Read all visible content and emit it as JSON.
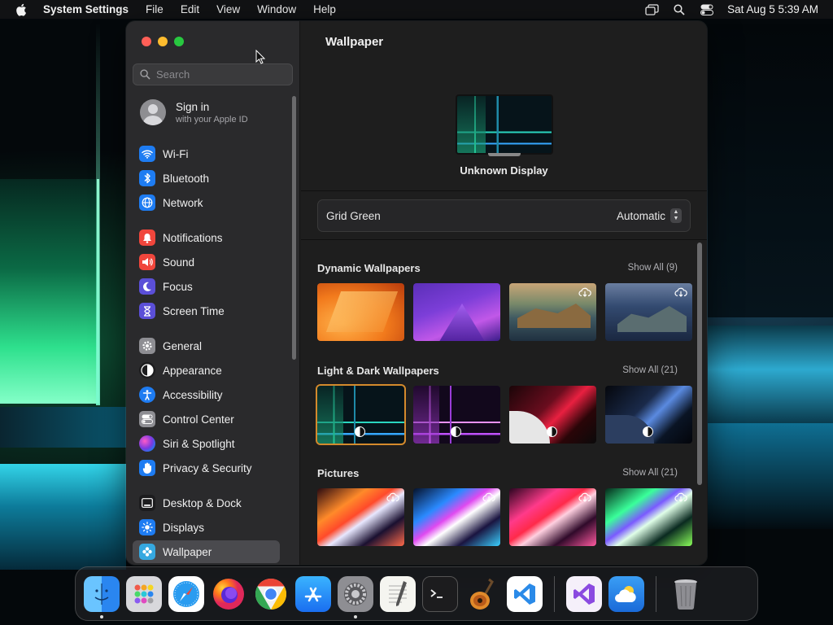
{
  "menubar": {
    "app_name": "System Settings",
    "menus": [
      "File",
      "Edit",
      "View",
      "Window",
      "Help"
    ],
    "clock": "Sat Aug 5  5:39 AM"
  },
  "sidebar": {
    "search_placeholder": "Search",
    "account": {
      "title": "Sign in",
      "subtitle": "with your Apple ID"
    },
    "items": [
      {
        "label": "Wi-Fi",
        "icon": "wifi-icon",
        "color": "#1e7cf2"
      },
      {
        "label": "Bluetooth",
        "icon": "bluetooth-icon",
        "color": "#1e7cf2"
      },
      {
        "label": "Network",
        "icon": "globe-icon",
        "color": "#1e7cf2"
      },
      {
        "label": "Notifications",
        "icon": "bell-icon",
        "color": "#f0463c"
      },
      {
        "label": "Sound",
        "icon": "speaker-icon",
        "color": "#f0463c"
      },
      {
        "label": "Focus",
        "icon": "moon-icon",
        "color": "#5b4fd8"
      },
      {
        "label": "Screen Time",
        "icon": "hourglass-icon",
        "color": "#5b4fd8"
      },
      {
        "label": "General",
        "icon": "gear-icon",
        "color": "#8e8e93"
      },
      {
        "label": "Appearance",
        "icon": "appearance-icon",
        "color": "#1c1c1e"
      },
      {
        "label": "Accessibility",
        "icon": "accessibility-icon",
        "color": "#1e7cf2"
      },
      {
        "label": "Control Center",
        "icon": "control-center-icon",
        "color": "#8e8e93"
      },
      {
        "label": "Siri & Spotlight",
        "icon": "siri-icon",
        "color": "#b03ad8"
      },
      {
        "label": "Privacy & Security",
        "icon": "hand-icon",
        "color": "#1e7cf2"
      },
      {
        "label": "Desktop & Dock",
        "icon": "dock-icon",
        "color": "#1c1c1e"
      },
      {
        "label": "Displays",
        "icon": "sun-icon",
        "color": "#1e7cf2"
      },
      {
        "label": "Wallpaper",
        "icon": "wallpaper-icon",
        "color": "#35a8e0"
      }
    ]
  },
  "main": {
    "title": "Wallpaper",
    "display_name": "Unknown Display",
    "current_wallpaper": "Grid Green",
    "mode": "Automatic",
    "sections": [
      {
        "title": "Dynamic Wallpapers",
        "show_all": "Show All (9)"
      },
      {
        "title": "Light & Dark Wallpapers",
        "show_all": "Show All (21)"
      },
      {
        "title": "Pictures",
        "show_all": "Show All (21)"
      }
    ]
  },
  "dock": {
    "apps": [
      "Finder",
      "Launchpad",
      "Safari",
      "Firefox",
      "Chrome",
      "App Store",
      "System Settings",
      "TextEdit",
      "Terminal",
      "GarageBand",
      "Visual Studio Code",
      "Visual Studio",
      "Weather",
      "Trash"
    ]
  }
}
